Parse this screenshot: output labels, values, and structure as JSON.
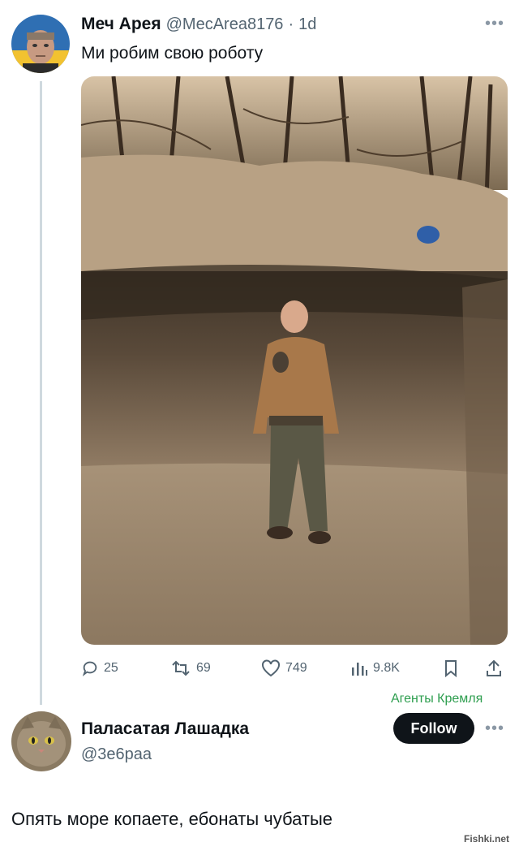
{
  "tweet": {
    "author_name": "Меч Арея",
    "handle": "@MecArea8176",
    "separator": "·",
    "time": "1d",
    "text": "Ми робим свою роботу",
    "image_alt": "man standing in a large dug pit in a forest"
  },
  "actions": {
    "reply_count": "25",
    "retweet_count": "69",
    "like_count": "749",
    "views_count": "9.8K"
  },
  "reply": {
    "watermark": "Агенты Кремля",
    "author_name": "Паласатая Лашадка",
    "handle": "@3e6paa",
    "follow_label": "Follow",
    "text": "Опять море копаете, ебонаты чубатые"
  },
  "site_watermark": "Fishki.net",
  "icons": [
    "more-icon",
    "reply-icon",
    "retweet-icon",
    "like-icon",
    "views-icon",
    "bookmark-icon",
    "share-icon"
  ],
  "colors": {
    "watermark_green": "#2e9e4f",
    "follow_bg": "#0f1419",
    "muted": "#536471"
  }
}
